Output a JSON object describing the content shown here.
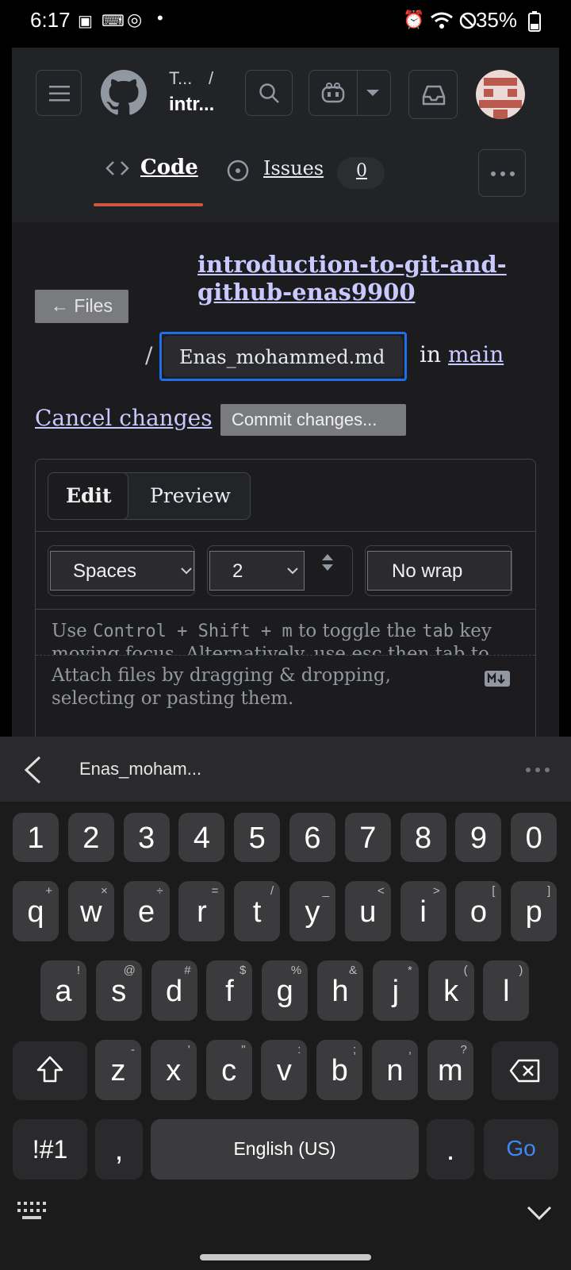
{
  "status": {
    "time": "6:17",
    "battery": "35%"
  },
  "header": {
    "owner_short": "T...",
    "separator": "/",
    "repo_short": "intr...",
    "tabs": [
      {
        "label": "Code"
      },
      {
        "label": "Issues",
        "count": "0"
      }
    ]
  },
  "editor": {
    "files_button": "← Files",
    "repo_link": "introduction-to-git-and-github-enas9900",
    "path_sep": "/",
    "filename": "Enas_mohammed.md",
    "in_text": "in",
    "branch": "main",
    "cancel": "Cancel changes",
    "commit": "Commit changes...",
    "tabs": [
      "Edit",
      "Preview"
    ],
    "indent_mode": "Spaces",
    "indent_size": "2",
    "wrap": "No wrap",
    "hint_use": "Use",
    "hint_keys": "Control + Shift + m",
    "hint_rest": "to toggle the",
    "hint_tab": "tab",
    "hint_key": "key",
    "hint_line2": "moving focus. Alternatively, use esc then tab to",
    "attach": "Attach files by dragging & dropping, selecting or pasting them."
  },
  "keyboard": {
    "toolbar_title": "Enas_moham...",
    "numbers": [
      "1",
      "2",
      "3",
      "4",
      "5",
      "6",
      "7",
      "8",
      "9",
      "0"
    ],
    "row1": [
      [
        "q",
        "+"
      ],
      [
        "w",
        "×"
      ],
      [
        "e",
        "÷"
      ],
      [
        "r",
        "="
      ],
      [
        "t",
        "/"
      ],
      [
        "y",
        "_"
      ],
      [
        "u",
        "<"
      ],
      [
        "i",
        ">"
      ],
      [
        "o",
        "["
      ],
      [
        "p",
        "]"
      ]
    ],
    "row2": [
      [
        "a",
        "!"
      ],
      [
        "s",
        "@"
      ],
      [
        "d",
        "#"
      ],
      [
        "f",
        "$"
      ],
      [
        "g",
        "%"
      ],
      [
        "h",
        "&"
      ],
      [
        "j",
        "*"
      ],
      [
        "k",
        "("
      ],
      [
        "l",
        ")"
      ]
    ],
    "row3": [
      [
        "z",
        "-"
      ],
      [
        "x",
        "'"
      ],
      [
        "c",
        "\""
      ],
      [
        "v",
        ":"
      ],
      [
        "b",
        ";"
      ],
      [
        "n",
        ","
      ],
      [
        "m",
        "?"
      ]
    ],
    "sym_key": "!#1",
    "comma": ",",
    "space": "English (US)",
    "period": ".",
    "go": "Go"
  },
  "colors": {
    "accent_underline": "#d0573e",
    "go_key": "#3d8af7",
    "focus_border": "#1f6feb"
  }
}
